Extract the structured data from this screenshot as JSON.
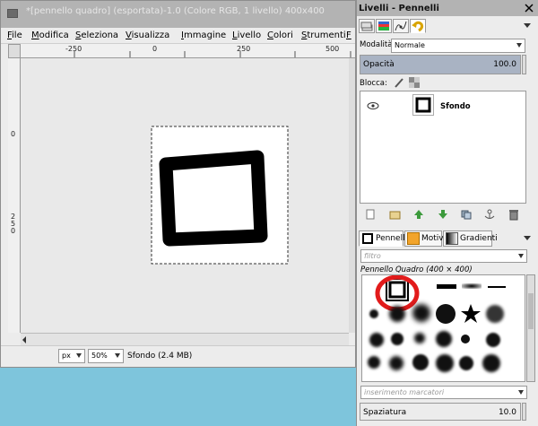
{
  "image_window": {
    "title": "*[pennello quadro] (esportata)-1.0 (Colore RGB, 1 livello) 400x400",
    "menu": [
      "File",
      "Modifica",
      "Seleziona",
      "Visualizza",
      "Immagine",
      "Livello",
      "Colori",
      "Strumenti",
      "F"
    ],
    "ruler_h_labels": [
      "-250",
      "0",
      "250",
      "500"
    ],
    "ruler_v_labels": [
      "0",
      "2",
      "5",
      "0"
    ],
    "status": {
      "unit": "px",
      "zoom": "50%",
      "layer_info": "Sfondo (2.4 MB)"
    }
  },
  "dock": {
    "title": "Livelli - Pennelli",
    "mode_label": "Modalità:",
    "mode_value": "Normale",
    "opacity_label": "Opacità",
    "opacity_value": "100.0",
    "lock_label": "Blocca:",
    "layer_name": "Sfondo",
    "tabs": {
      "brushes": "Pennelli",
      "patterns": "Motivi",
      "gradients": "Gradienti"
    },
    "filter_placeholder": "filtro",
    "brush_title": "Pennello Quadro (400 × 400)",
    "tags_placeholder": "inserimento marcatori",
    "spacing_label": "Spaziatura",
    "spacing_value": "10.0",
    "accent_color": "#e21b1b"
  }
}
